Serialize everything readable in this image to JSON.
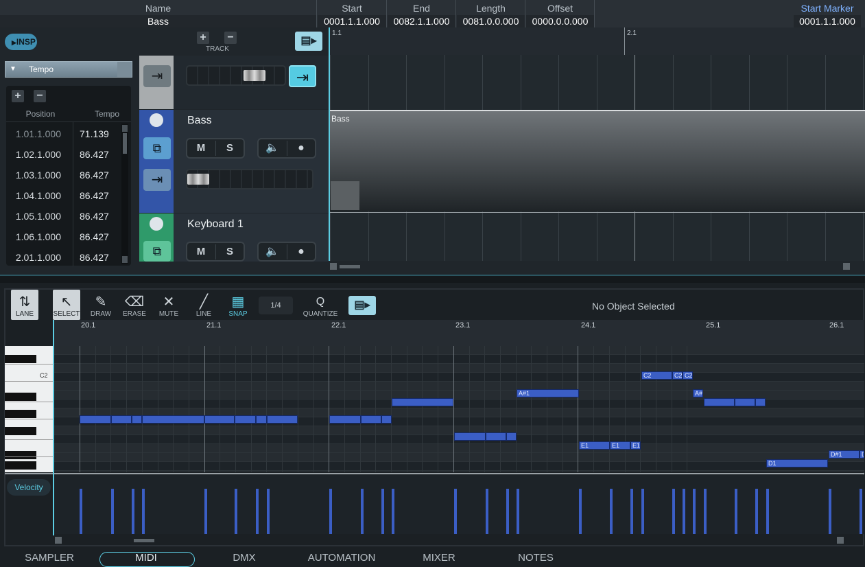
{
  "infobar": {
    "name_label": "Name",
    "name_value": "Bass",
    "start_label": "Start",
    "start_value": "0001.1.1.000",
    "end_label": "End",
    "end_value": "0082.1.1.000",
    "length_label": "Length",
    "length_value": "0081.0.0.000",
    "offset_label": "Offset",
    "offset_value": "0000.0.0.000",
    "start_marker_label": "Start Marker",
    "start_marker_value": "0001.1.1.000"
  },
  "arrange": {
    "insp_label": "INSP",
    "track_label": "TRACK",
    "ruler": {
      "mark1": "1.1",
      "mark2": "2.1"
    },
    "clip_label": "Bass"
  },
  "tempo": {
    "dropdown_label": "Tempo",
    "col_position": "Position",
    "col_tempo": "Tempo",
    "rows": [
      {
        "position": "1.01.1.000",
        "tempo": "71.139"
      },
      {
        "position": "1.02.1.000",
        "tempo": "86.427"
      },
      {
        "position": "1.03.1.000",
        "tempo": "86.427"
      },
      {
        "position": "1.04.1.000",
        "tempo": "86.427"
      },
      {
        "position": "1.05.1.000",
        "tempo": "86.427"
      },
      {
        "position": "1.06.1.000",
        "tempo": "86.427"
      },
      {
        "position": "2.01.1.000",
        "tempo": "86.427"
      }
    ]
  },
  "tracks": [
    {
      "name": "Bass",
      "mute": "M",
      "solo": "S"
    },
    {
      "name": "Keyboard 1",
      "mute": "M",
      "solo": "S"
    }
  ],
  "pianoroll": {
    "tools": [
      "LANE",
      "SELECT",
      "DRAW",
      "ERASE",
      "MUTE",
      "LINE",
      "SNAP"
    ],
    "grid_value": "1/4",
    "quantize_symbol": "Q",
    "quantize_label": "QUANTIZE",
    "status": "No Object Selected",
    "ruler_marks": [
      "20.1",
      "21.1",
      "22.1",
      "23.1",
      "24.1",
      "25.1",
      "26.1"
    ],
    "key_label": "C2",
    "velocity_label": "Velocity",
    "note_labels": [
      "C2",
      "C2",
      "C2",
      "A#1",
      "A#",
      "E1",
      "E1",
      "E1",
      "D1",
      "D#1",
      "D"
    ]
  },
  "bottom_tabs": [
    "SAMPLER",
    "MIDI",
    "DMX",
    "AUTOMATION",
    "MIXER",
    "NOTES"
  ],
  "colors": {
    "accent": "#5ccde3",
    "note": "#3b5ec5",
    "bass_track": "#3355a8",
    "keyboard_track": "#2f9a6a"
  }
}
